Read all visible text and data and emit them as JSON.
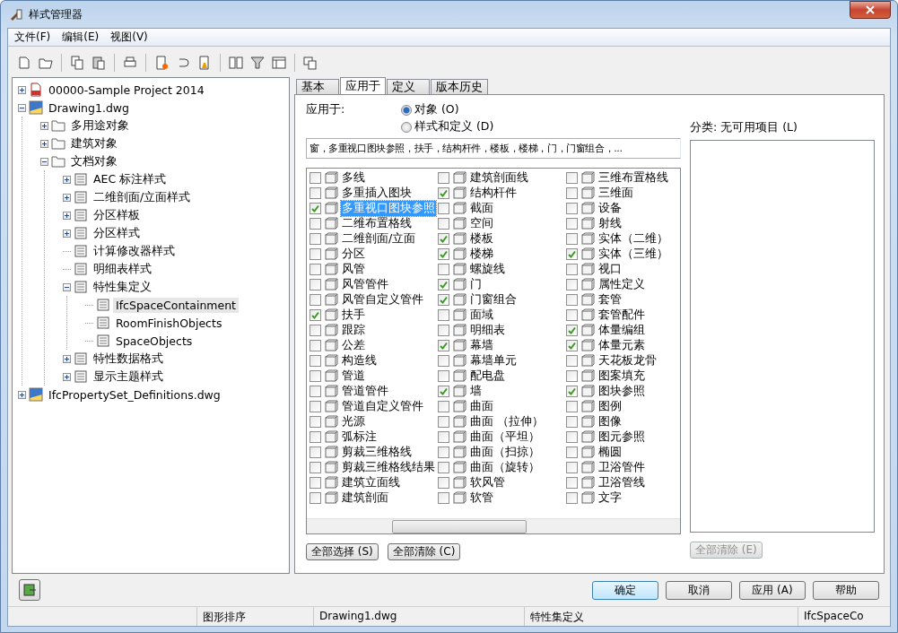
{
  "window": {
    "title": "样式管理器"
  },
  "menu": [
    "文件(F)",
    "编辑(E)",
    "视图(V)"
  ],
  "tree": [
    {
      "label": "00000-Sample Project 2014",
      "expanded": false,
      "selected": false
    },
    {
      "label": "Drawing1.dwg",
      "expanded": true,
      "selected": false,
      "children": [
        {
          "label": "多用途对象",
          "expanded": false,
          "selected": false
        },
        {
          "label": "建筑对象",
          "expanded": false,
          "selected": false
        },
        {
          "label": "文档对象",
          "expanded": true,
          "selected": false,
          "children": [
            {
              "label": "AEC 标注样式",
              "expanded": false,
              "selected": false
            },
            {
              "label": "二维剖面/立面样式",
              "expanded": false,
              "selected": false
            },
            {
              "label": "分区样板",
              "expanded": false,
              "selected": false
            },
            {
              "label": "分区样式",
              "expanded": false,
              "selected": false
            },
            {
              "label": "计算修改器样式",
              "selected": false
            },
            {
              "label": "明细表样式",
              "selected": false
            },
            {
              "label": "特性集定义",
              "expanded": true,
              "selected": false,
              "children": [
                {
                  "label": "IfcSpaceContainment",
                  "selected": true
                },
                {
                  "label": "RoomFinishObjects",
                  "selected": false
                },
                {
                  "label": "SpaceObjects",
                  "selected": false
                }
              ]
            },
            {
              "label": "特性数据格式",
              "expanded": false,
              "selected": false
            },
            {
              "label": "显示主题样式",
              "expanded": false,
              "selected": false
            }
          ]
        }
      ]
    },
    {
      "label": "IfcPropertySet_Definitions.dwg",
      "expanded": false,
      "selected": false
    }
  ],
  "tabs": [
    {
      "label": "基本",
      "selected": false
    },
    {
      "label": "应用于",
      "selected": true
    },
    {
      "label": "定义",
      "selected": false
    },
    {
      "label": "版本历史",
      "selected": false
    }
  ],
  "applies_to": {
    "label": "应用于:",
    "options": [
      {
        "label": "对象 (O)",
        "selected": true
      },
      {
        "label": "样式和定义 (D)",
        "selected": false
      }
    ],
    "summary": "窗，多重视口图块参照，扶手，结构杆件，楼板，楼梯，门，门窗组合，..."
  },
  "object_types": [
    [
      {
        "label": "多线",
        "checked": false,
        "selected": false
      },
      {
        "label": "多重插入图块",
        "checked": false,
        "selected": false
      },
      {
        "label": "多重视口图块参照",
        "checked": true,
        "selected": true
      },
      {
        "label": "二维布置格线",
        "checked": false,
        "selected": false
      },
      {
        "label": "二维剖面/立面",
        "checked": false,
        "selected": false
      },
      {
        "label": "分区",
        "checked": false,
        "selected": false
      },
      {
        "label": "风管",
        "checked": false,
        "selected": false
      },
      {
        "label": "风管管件",
        "checked": false,
        "selected": false
      },
      {
        "label": "风管自定义管件",
        "checked": false,
        "selected": false
      },
      {
        "label": "扶手",
        "checked": true,
        "selected": false
      },
      {
        "label": "跟踪",
        "checked": false,
        "selected": false
      },
      {
        "label": "公差",
        "checked": false,
        "selected": false
      },
      {
        "label": "构造线",
        "checked": false,
        "selected": false
      },
      {
        "label": "管道",
        "checked": false,
        "selected": false
      },
      {
        "label": "管道管件",
        "checked": false,
        "selected": false
      },
      {
        "label": "管道自定义管件",
        "checked": false,
        "selected": false
      },
      {
        "label": "光源",
        "checked": false,
        "selected": false
      },
      {
        "label": "弧标注",
        "checked": false,
        "selected": false
      },
      {
        "label": "剪裁三维格线",
        "checked": false,
        "selected": false
      },
      {
        "label": "剪裁三维格线结果",
        "checked": false,
        "selected": false
      },
      {
        "label": "建筑立面线",
        "checked": false,
        "selected": false
      },
      {
        "label": "建筑剖面",
        "checked": false,
        "selected": false
      }
    ],
    [
      {
        "label": "建筑剖面线",
        "checked": false,
        "selected": false
      },
      {
        "label": "结构杆件",
        "checked": true,
        "selected": false
      },
      {
        "label": "截面",
        "checked": false,
        "selected": false
      },
      {
        "label": "空间",
        "checked": false,
        "selected": false
      },
      {
        "label": "楼板",
        "checked": true,
        "selected": false
      },
      {
        "label": "楼梯",
        "checked": true,
        "selected": false
      },
      {
        "label": "螺旋线",
        "checked": false,
        "selected": false
      },
      {
        "label": "门",
        "checked": true,
        "selected": false
      },
      {
        "label": "门窗组合",
        "checked": true,
        "selected": false
      },
      {
        "label": "面域",
        "checked": false,
        "selected": false
      },
      {
        "label": "明细表",
        "checked": false,
        "selected": false
      },
      {
        "label": "幕墙",
        "checked": true,
        "selected": false
      },
      {
        "label": "幕墙单元",
        "checked": false,
        "selected": false
      },
      {
        "label": "配电盘",
        "checked": false,
        "selected": false
      },
      {
        "label": "墙",
        "checked": true,
        "selected": false
      },
      {
        "label": "曲面",
        "checked": false,
        "selected": false
      },
      {
        "label": "曲面 （拉伸）",
        "checked": false,
        "selected": false
      },
      {
        "label": "曲面（平坦）",
        "checked": false,
        "selected": false
      },
      {
        "label": "曲面（扫掠）",
        "checked": false,
        "selected": false
      },
      {
        "label": "曲面（旋转）",
        "checked": false,
        "selected": false
      },
      {
        "label": "软风管",
        "checked": false,
        "selected": false
      },
      {
        "label": "软管",
        "checked": false,
        "selected": false
      }
    ],
    [
      {
        "label": "三维布置格线",
        "checked": false,
        "selected": false
      },
      {
        "label": "三维面",
        "checked": false,
        "selected": false
      },
      {
        "label": "设备",
        "checked": false,
        "selected": false
      },
      {
        "label": "射线",
        "checked": false,
        "selected": false
      },
      {
        "label": "实体（二维）",
        "checked": false,
        "selected": false
      },
      {
        "label": "实体（三维）",
        "checked": true,
        "selected": false
      },
      {
        "label": "视口",
        "checked": false,
        "selected": false
      },
      {
        "label": "属性定义",
        "checked": false,
        "selected": false
      },
      {
        "label": "套管",
        "checked": false,
        "selected": false
      },
      {
        "label": "套管配件",
        "checked": false,
        "selected": false
      },
      {
        "label": "体量编组",
        "checked": true,
        "selected": false
      },
      {
        "label": "体量元素",
        "checked": true,
        "selected": false
      },
      {
        "label": "天花板龙骨",
        "checked": false,
        "selected": false
      },
      {
        "label": "图案填充",
        "checked": false,
        "selected": false
      },
      {
        "label": "图块参照",
        "checked": true,
        "selected": false
      },
      {
        "label": "图例",
        "checked": false,
        "selected": false
      },
      {
        "label": "图像",
        "checked": false,
        "selected": false
      },
      {
        "label": "图元参照",
        "checked": false,
        "selected": false
      },
      {
        "label": "椭圆",
        "checked": false,
        "selected": false
      },
      {
        "label": "卫浴管件",
        "checked": false,
        "selected": false
      },
      {
        "label": "卫浴管线",
        "checked": false,
        "selected": false
      },
      {
        "label": "文字",
        "checked": false,
        "selected": false
      }
    ]
  ],
  "list_buttons": [
    {
      "label": "全部选择 (S)",
      "disabled": false
    },
    {
      "label": "全部清除 (C)",
      "disabled": false
    }
  ],
  "classification": {
    "label": "分类: 无可用项目 (L)",
    "button": {
      "label": "全部清除 (E)",
      "disabled": true
    }
  },
  "dialog_buttons": [
    {
      "label": "确定",
      "default": true
    },
    {
      "label": "取消",
      "default": false
    },
    {
      "label": "应用 (A)",
      "default": false
    },
    {
      "label": "帮助",
      "default": false
    }
  ],
  "status_bar": [
    "图形排序",
    "Drawing1.dwg",
    "特性集定义",
    "IfcSpaceCo"
  ]
}
